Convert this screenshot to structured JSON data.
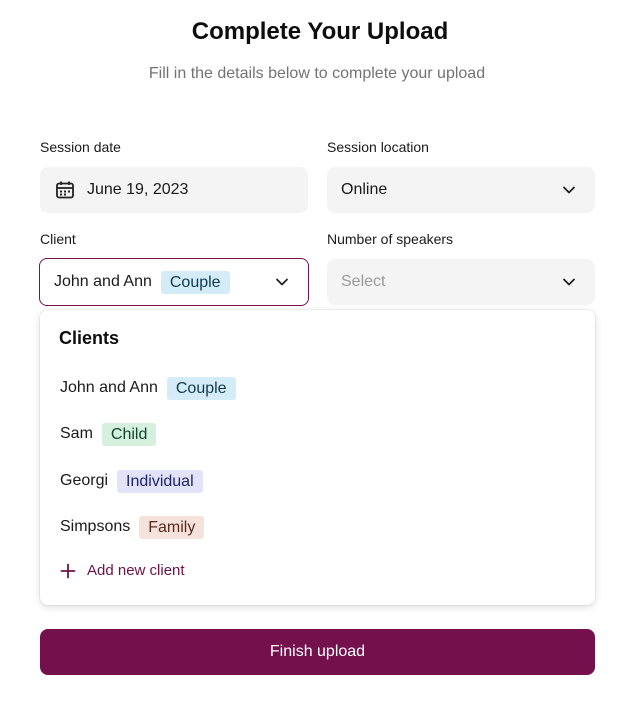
{
  "header": {
    "title": "Complete Your Upload",
    "subtitle": "Fill in the details below to complete your upload"
  },
  "fields": {
    "session_date": {
      "label": "Session date",
      "value": "June 19, 2023",
      "icon": "calendar-icon"
    },
    "session_location": {
      "label": "Session location",
      "value": "Online",
      "icon": "chevron-down-icon"
    },
    "client": {
      "label": "Client",
      "value": "John and Ann",
      "tag": "Couple",
      "icon": "chevron-down-icon"
    },
    "speakers": {
      "label": "Number of speakers",
      "placeholder": "Select",
      "icon": "chevron-down-icon"
    }
  },
  "dropdown": {
    "title": "Clients",
    "items": [
      {
        "name": "John and Ann",
        "tag": "Couple",
        "tag_color": "#d4ecf7"
      },
      {
        "name": "Sam",
        "tag": "Child",
        "tag_color": "#d5f0df"
      },
      {
        "name": "Georgi",
        "tag": "Individual",
        "tag_color": "#e2e3f9"
      },
      {
        "name": "Simpsons",
        "tag": "Family",
        "tag_color": "#f5e2da"
      }
    ],
    "add_label": "Add new client",
    "add_icon": "plus-icon"
  },
  "actions": {
    "finish_label": "Finish upload"
  },
  "colors": {
    "accent": "#74104c",
    "field_bg": "#f4f4f4"
  }
}
